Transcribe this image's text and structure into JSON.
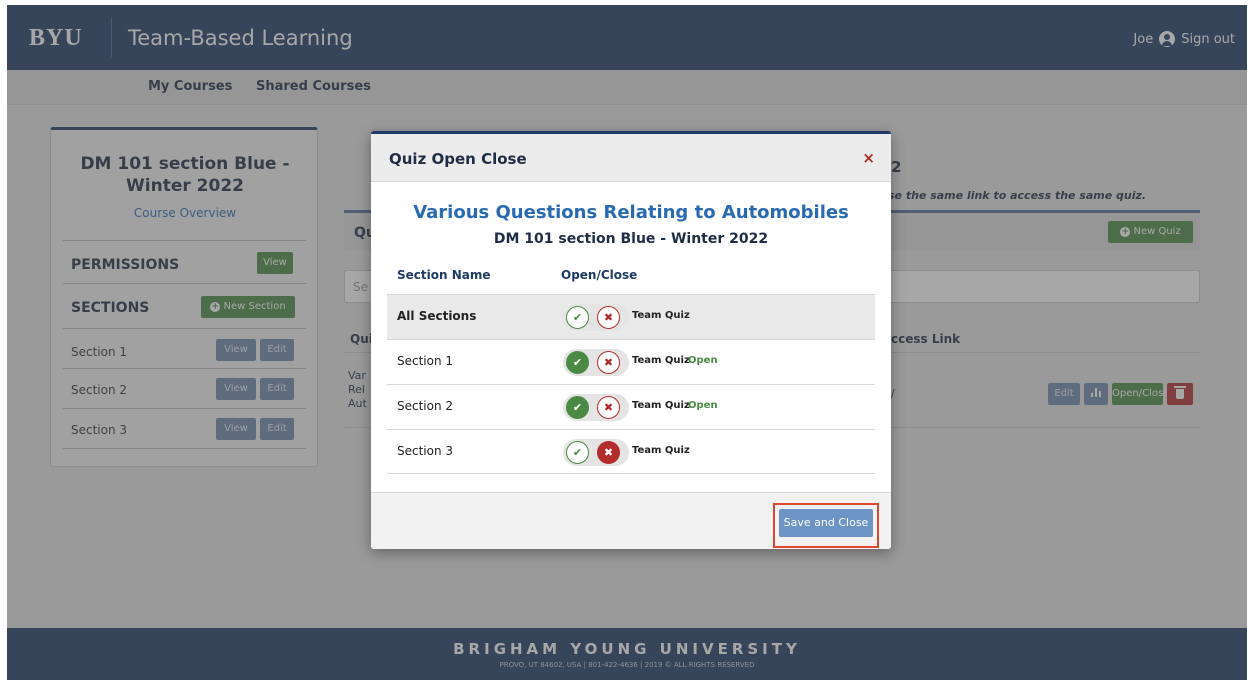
{
  "header": {
    "logo": "BYU",
    "app_title": "Team-Based Learning",
    "user_name": "Joe",
    "sign_out": "Sign out"
  },
  "nav": {
    "my_courses": "My Courses",
    "shared_courses": "Shared Courses"
  },
  "sidebar": {
    "course_title_line1": "DM 101 section Blue -",
    "course_title_line2": "Winter 2022",
    "course_overview": "Course Overview",
    "permissions_label": "PERMISSIONS",
    "permissions_view": "View",
    "sections_label": "SECTIONS",
    "new_section": "New Section",
    "sections": [
      {
        "name": "Section 1",
        "view": "View",
        "edit": "Edit"
      },
      {
        "name": "Section 2",
        "view": "View",
        "edit": "Edit"
      },
      {
        "name": "Section 3",
        "view": "View",
        "edit": "Edit"
      }
    ]
  },
  "main": {
    "heading_fragment": "2",
    "instruction_fragment": "se the same link to access the same quiz.",
    "tab_fragment": "Qu",
    "new_quiz": "New Quiz",
    "search_fragment": "Se",
    "col_quiz_fragment": "Qui",
    "col_access_fragment": "ccess Link",
    "row_fragment_1": "Var",
    "row_fragment_2": "Rel",
    "row_fragment_3": "Aut",
    "row_slash": "/",
    "edit": "Edit",
    "open_close": "Open/Close"
  },
  "modal": {
    "title": "Quiz Open Close",
    "close_symbol": "×",
    "quiz_title": "Various Questions Relating to Automobiles",
    "course_subtitle": "DM 101 section Blue - Winter 2022",
    "col_section": "Section Name",
    "col_open_close": "Open/Close",
    "rows": [
      {
        "name": "All Sections",
        "quiz": "Team Quiz",
        "status": "",
        "state": "neutral"
      },
      {
        "name": "Section 1",
        "quiz": "Team Quiz",
        "status": "Open",
        "state": "open"
      },
      {
        "name": "Section 2",
        "quiz": "Team Quiz",
        "status": "Open",
        "state": "open"
      },
      {
        "name": "Section 3",
        "quiz": "Team Quiz",
        "status": "",
        "state": "closed"
      }
    ],
    "save_button": "Save and Close"
  },
  "footer": {
    "university": "BRIGHAM YOUNG UNIVERSITY",
    "address": "PROVO, UT 84602, USA | 801-422-4636 | 2019 © ALL RIGHTS RESERVED"
  },
  "icons": {
    "check": "✔",
    "cross": "✖",
    "plus": "+",
    "bar_chart": "bar-chart-icon",
    "trash": "trash-icon",
    "user": "user-icon"
  },
  "colors": {
    "brand_navy": "#1f3a66",
    "green": "#4a8a44",
    "red": "#b32c2c",
    "link_blue": "#2a6ab0",
    "steel_button": "#6c88ad",
    "highlight_border": "#e0472f"
  }
}
